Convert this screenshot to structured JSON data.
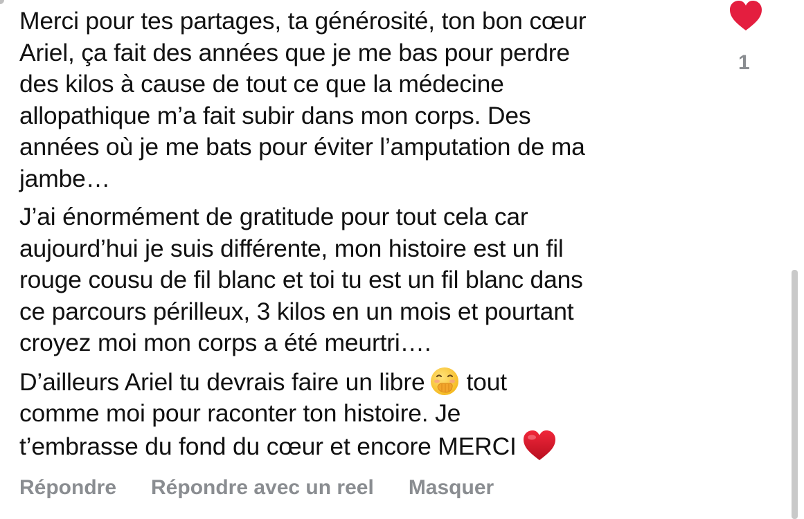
{
  "comment": {
    "paragraphs": [
      {
        "lines": [
          "Merci pour tes partages, ta générosité, ton bon cœur",
          "Ariel, ça fait des années que je me bas pour perdre",
          "des kilos à cause de tout ce que la médecine",
          "allopathique m’a fait subir dans mon corps. Des",
          "années où je me bats pour éviter l’amputation de ma",
          "jambe…"
        ]
      },
      {
        "lines": [
          "J’ai énormément de gratitude pour tout cela car",
          "aujourd’hui je suis différente, mon histoire est un fil",
          "rouge cousu de fil blanc et toi tu est un fil blanc dans",
          "ce parcours périlleux, 3 kilos en un mois et pourtant",
          "croyez moi mon corps a été meurtri…."
        ]
      },
      {
        "line1_before": "D’ailleurs Ariel tu devrais faire un libre",
        "line1_after": "tout",
        "line2": "comme moi pour raconter ton histoire.  Je",
        "line3": "t’embrasse du fond du cœur et encore MERCI"
      }
    ],
    "emoji_icons": [
      "hand-over-mouth-emoji-icon",
      "red-heart-emoji-icon"
    ]
  },
  "reaction": {
    "icon": "heart-icon",
    "color": "#e41e3f",
    "count": "1"
  },
  "actions": {
    "reply": "Répondre",
    "reply_reel": "Répondre avec un reel",
    "hide": "Masquer"
  },
  "colors": {
    "text": "#111111",
    "muted": "#8a8d91"
  }
}
